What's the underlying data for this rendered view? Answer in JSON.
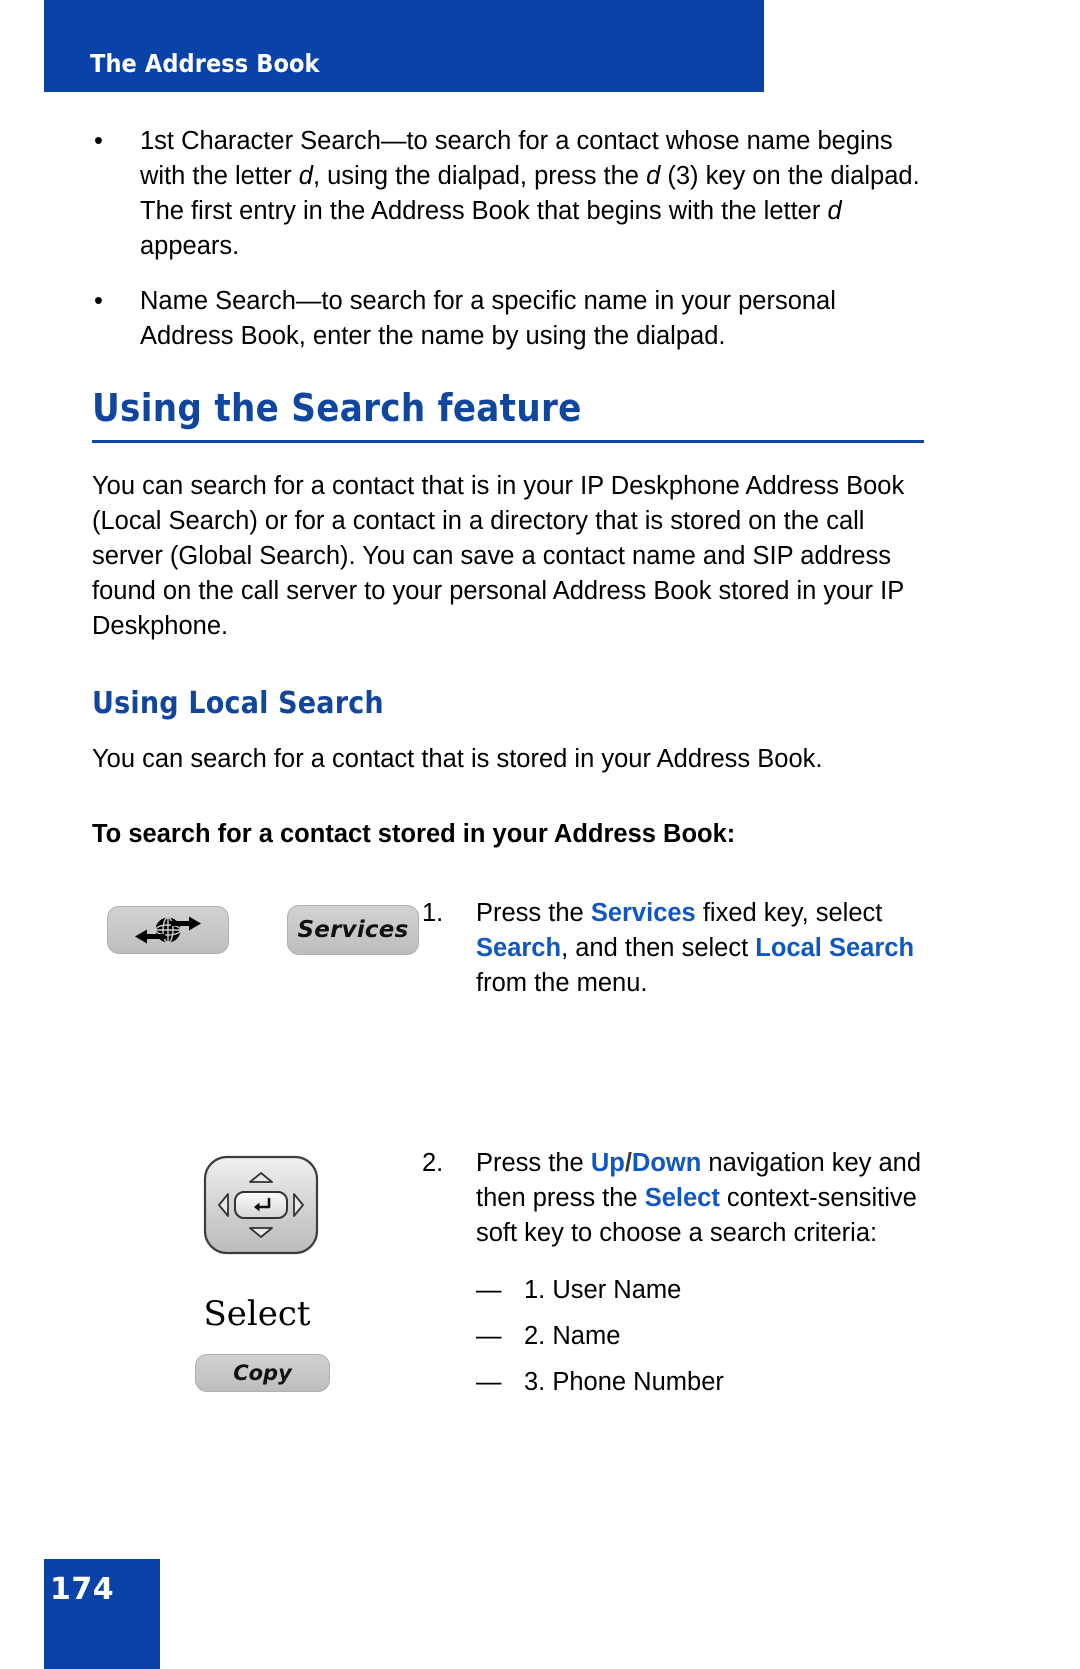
{
  "header": {
    "title": "The Address Book",
    "banner_color": "#0a43a8"
  },
  "bullets": [
    {
      "pre": "1st Character Search—to search for a contact whose name begins with the letter ",
      "em1": "d",
      "mid1": ", using the dialpad, press the ",
      "em2": "d",
      "mid2": " (3) key on the dialpad. The first entry in the Address Book that begins with the letter ",
      "em3": "d",
      "post": " appears."
    },
    {
      "text": "Name Search—to search for a specific name in your personal Address Book, enter the name by using the dialpad."
    }
  ],
  "section": {
    "heading": "Using the Search feature",
    "heading_color": "#11469f",
    "paragraph": "You can search for a contact that is in your IP Deskphone Address Book (Local Search) or for a contact in a directory that is stored on the call server (Global Search). You can save a contact name and SIP address found on the call server to your personal Address Book stored in your IP Deskphone."
  },
  "subsection": {
    "heading": "Using Local Search",
    "paragraph": "You can search for a contact that is stored in your Address Book.",
    "bold_lead": "To search for a contact stored in your Address Book:"
  },
  "steps": [
    {
      "number": "1.",
      "segments": [
        {
          "text": "Press the ",
          "style": "plain"
        },
        {
          "text": "Services",
          "style": "keyword"
        },
        {
          "text": " fixed key, select ",
          "style": "plain"
        },
        {
          "text": "Search",
          "style": "keyword"
        },
        {
          "text": ", and then select ",
          "style": "plain"
        },
        {
          "text": "Local Search",
          "style": "keyword"
        },
        {
          "text": " from the menu.",
          "style": "plain"
        }
      ],
      "art": {
        "globe_key_name": "globe-services-fixed-key",
        "services_key_label": "Services"
      }
    },
    {
      "number": "2.",
      "segments": [
        {
          "text": "Press the ",
          "style": "plain"
        },
        {
          "text": "Up",
          "style": "keyword"
        },
        {
          "text": "/",
          "style": "slash"
        },
        {
          "text": "Down",
          "style": "keyword"
        },
        {
          "text": " navigation key and then press the ",
          "style": "plain"
        },
        {
          "text": "Select",
          "style": "keyword"
        },
        {
          "text": " context-sensitive soft key to choose a search criteria:",
          "style": "plain"
        }
      ],
      "criteria": [
        "1. User Name",
        "2. Name",
        "3. Phone Number"
      ],
      "art": {
        "nav_key_name": "navigation-cluster-key",
        "select_label": "Select",
        "copy_key_label": "Copy"
      }
    }
  ],
  "footer": {
    "page_number": "174",
    "block_color": "#0a43a8"
  },
  "colors": {
    "brand_blue": "#0a43a8",
    "heading_blue": "#11469f",
    "keyword_blue": "#1157c4"
  }
}
